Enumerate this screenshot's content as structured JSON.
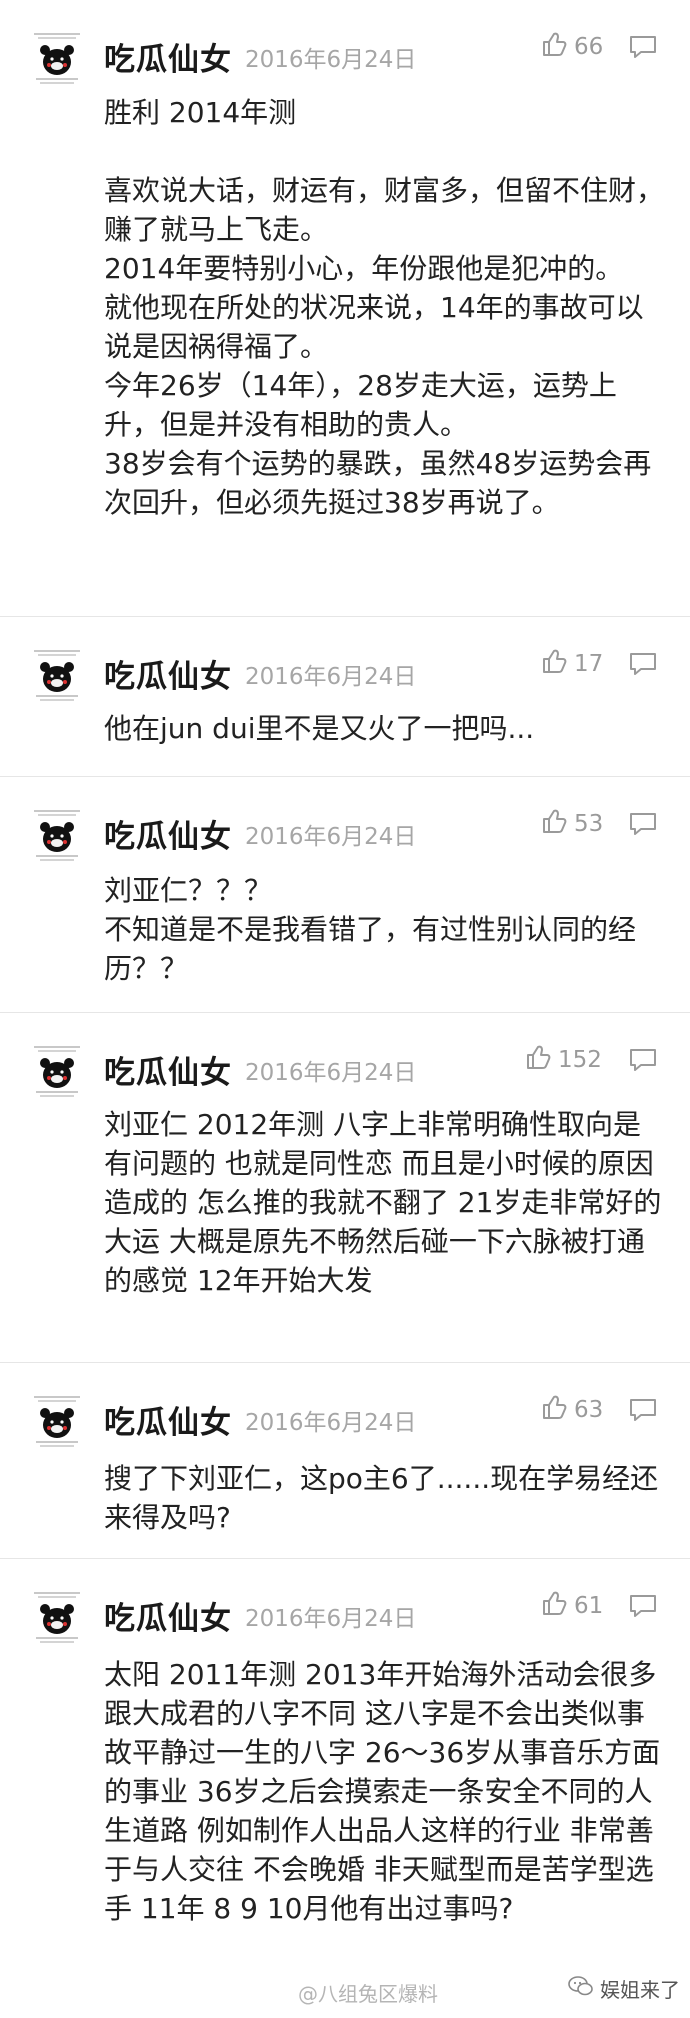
{
  "comments": [
    {
      "user": "吃瓜仙女",
      "date": "2016年6月24日",
      "likes": "66",
      "paragraphs": [
        "胜利 2014年测",
        "喜欢说大话，财运有，财富多，但留不住财，赚了就马上飞走。",
        "2014年要特别小心，年份跟他是犯冲的。",
        "就他现在所处的状况来说，14年的事故可以说是因祸得福了。",
        "今年26岁（14年），28岁走大运，运势上升，但是并没有相助的贵人。",
        "38岁会有个运势的暴跌，虽然48岁运势会再次回升，但必须先挺过38岁再说了。"
      ]
    },
    {
      "user": "吃瓜仙女",
      "date": "2016年6月24日",
      "likes": "17",
      "paragraphs": [
        "他在jun dui里不是又火了一把吗..."
      ]
    },
    {
      "user": "吃瓜仙女",
      "date": "2016年6月24日",
      "likes": "53",
      "paragraphs": [
        "刘亚仁？？？",
        "不知道是不是我看错了，有过性别认同的经历？？"
      ]
    },
    {
      "user": "吃瓜仙女",
      "date": "2016年6月24日",
      "likes": "152",
      "paragraphs": [
        "刘亚仁 2012年测 八字上非常明确性取向是有问题的 也就是同性恋 而且是小时候的原因造成的 怎么推的我就不翻了 21岁走非常好的大运 大概是原先不畅然后碰一下六脉被打通的感觉 12年开始大发"
      ]
    },
    {
      "user": "吃瓜仙女",
      "date": "2016年6月24日",
      "likes": "63",
      "paragraphs": [
        "搜了下刘亚仁，这po主6了......现在学易经还来得及吗?"
      ]
    },
    {
      "user": "吃瓜仙女",
      "date": "2016年6月24日",
      "likes": "61",
      "paragraphs": [
        "太阳 2011年测 2013年开始海外活动会很多 跟大成君的八字不同 这八字是不会出类似事故平静过一生的八字 26～36岁从事音乐方面的事业 36岁之后会摸索走一条安全不同的人生道路 例如制作人出品人这样的行业 非常善于与人交往 不会晚婚 非天赋型而是苦学型选手 11年 8 9 10月他有出过事吗?"
      ]
    }
  ],
  "footer": {
    "watermark": "@八组兔区爆料",
    "wechat_label": "娱姐来了"
  }
}
